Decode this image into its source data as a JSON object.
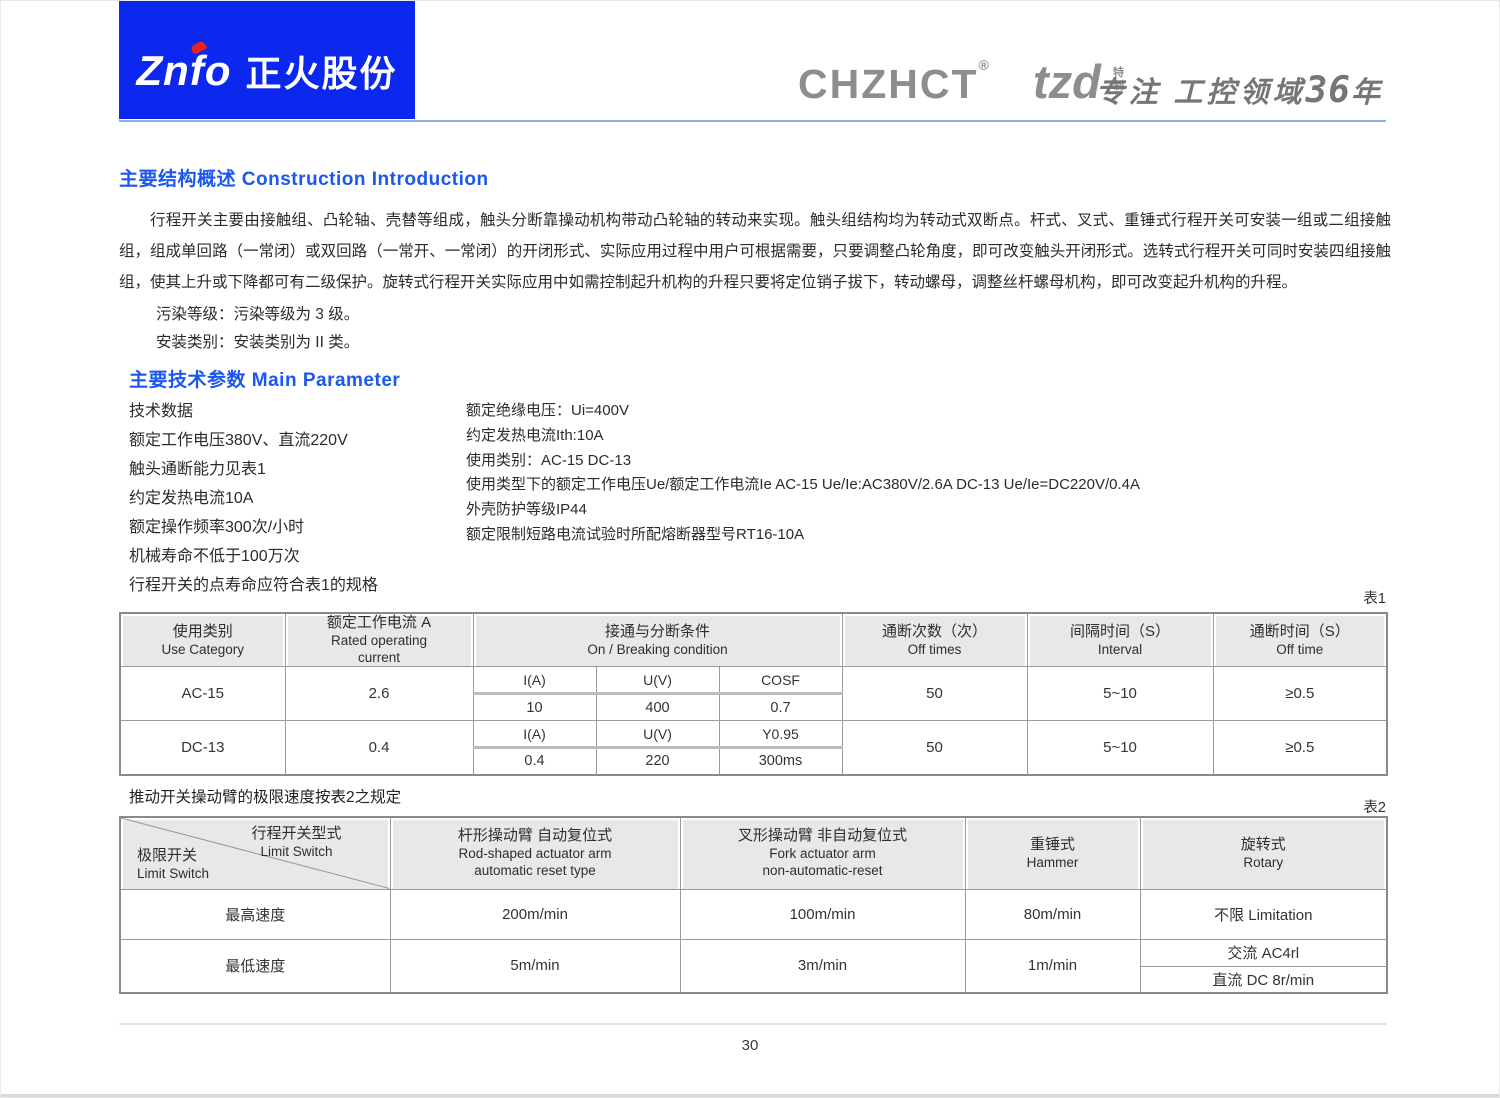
{
  "header": {
    "logo": {
      "latin": "Znfo",
      "cn": "正火股份"
    },
    "brand_name": "CHZHCT",
    "brand_reg": "®",
    "sub_brand": "tzd",
    "sub_brand_note": "特制",
    "slogan_prefix": "专注 工控领域",
    "slogan_num": "36",
    "slogan_suffix": "年"
  },
  "construction": {
    "title": "主要结构概述 Construction Introduction",
    "paragraph": "行程开关主要由接触组、凸轮轴、壳替等组成，触头分断靠操动机构带动凸轮轴的转动来实现。触头组结构均为转动式双断点。杆式、叉式、重锤式行程开关可安装一组或二组接触组，组成单回路（一常闭）或双回路（一常开、一常闭）的开闭形式、实际应用过程中用户可根据需要，只要调整凸轮角度，即可改变触头开闭形式。选转式行程开关可同时安装四组接触组，使其上升或下降都可有二级保护。旋转式行程开关实际应用中如需控制起升机构的升程只要将定位销子拔下，转动螺母，调整丝杆螺母机构，即可改变起升机构的升程。",
    "note_pollution": "污染等级：污染等级为 3 级。",
    "note_install": "安装类别：安装类别为 II 类。"
  },
  "parameters": {
    "title": "主要技术参数 Main Parameter",
    "left": [
      "技术数据",
      "额定工作电压380V、直流220V",
      "触头通断能力见表1",
      "约定发热电流10A",
      "额定操作频率300次/小时",
      "机械寿命不低于100万次",
      "行程开关的点寿命应符合表1的规格"
    ],
    "right": [
      "额定绝缘电压：Ui=400V",
      "约定发热电流Ith:10A",
      "使用类别：AC-15  DC-13",
      "使用类型下的额定工作电压Ue/额定工作电流Ie AC-15  Ue/Ie:AC380V/2.6A DC-13 Ue/Ie=DC220V/0.4A",
      "外壳防护等级IP44",
      "额定限制短路电流试验时所配熔断器型号RT16-10A"
    ]
  },
  "table1": {
    "label": "表1",
    "headers": {
      "use_category": {
        "cn": "使用类别",
        "en": "Use Category"
      },
      "rated_current": {
        "cn": "额定工作电流 A",
        "en": "Rated operating",
        "en2": "current"
      },
      "condition": {
        "cn": "接通与分断条件",
        "en": "On / Breaking condition"
      },
      "off_times": {
        "cn": "通断次数（次）",
        "en": "Off times"
      },
      "interval": {
        "cn": "间隔时间（S）",
        "en": "Interval"
      },
      "off_time": {
        "cn": "通断时间（S）",
        "en": "Off time"
      }
    },
    "rows": [
      {
        "category": "AC-15",
        "current": "2.6",
        "sub_head": [
          "I(A)",
          "U(V)",
          "COSF"
        ],
        "sub_vals": [
          "10",
          "400",
          "0.7"
        ],
        "off_times": "50",
        "interval": "5~10",
        "off_time": "≥0.5"
      },
      {
        "category": "DC-13",
        "current": "0.4",
        "sub_head": [
          "I(A)",
          "U(V)",
          "Y0.95"
        ],
        "sub_vals": [
          "0.4",
          "220",
          "300ms"
        ],
        "off_times": "50",
        "interval": "5~10",
        "off_time": "≥0.5"
      }
    ]
  },
  "table2": {
    "intro": "推动开关操动臂的极限速度按表2之规定",
    "label": "表2",
    "corner": {
      "top_cn": "行程开关型式",
      "top_en": "Limit Switch",
      "bottom_cn": "极限开关",
      "bottom_en": "Limit Switch"
    },
    "headers": [
      {
        "cn": "杆形操动臂 自动复位式",
        "en": "Rod-shaped actuator arm",
        "en2": "automatic reset type"
      },
      {
        "cn": "叉形操动臂 非自动复位式",
        "en": "Fork actuator arm",
        "en2": "non-automatic-reset"
      },
      {
        "cn": "重锤式",
        "en": "Hammer"
      },
      {
        "cn": "旋转式",
        "en": "Rotary"
      }
    ],
    "rows": [
      {
        "label": "最高速度",
        "rod": "200m/min",
        "fork": "100m/min",
        "hammer": "80m/min",
        "rotary": "不限 Limitation"
      },
      {
        "label": "最低速度",
        "rod": "5m/min",
        "fork": "3m/min",
        "hammer": "1m/min",
        "rotary_ac": "交流 AC4rl",
        "rotary_dc": "直流 DC 8r/min"
      }
    ]
  },
  "footer": {
    "page_number": "30"
  }
}
